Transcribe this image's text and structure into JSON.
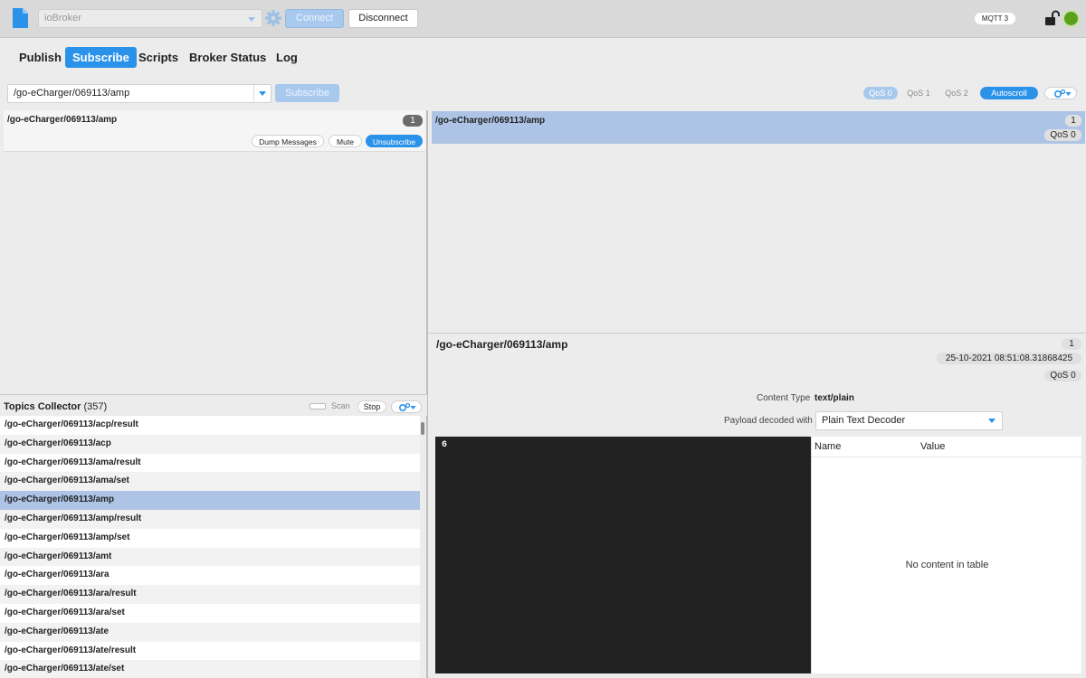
{
  "toolbar": {
    "profile_value": "ioBroker",
    "connect_label": "Connect",
    "disconnect_label": "Disconnect",
    "protocol_badge": "MQTT 3",
    "connection_status_color": "#5aa01a"
  },
  "tabs": [
    {
      "label": "Publish",
      "active": false
    },
    {
      "label": "Subscribe",
      "active": true
    },
    {
      "label": "Scripts",
      "active": false
    },
    {
      "label": "Broker Status",
      "active": false
    },
    {
      "label": "Log",
      "active": false
    }
  ],
  "subscribe_bar": {
    "topic_value": "/go-eCharger/069113/amp",
    "subscribe_label": "Subscribe",
    "qos_options": [
      "QoS 0",
      "QoS 1",
      "QoS 2"
    ],
    "qos_selected": "QoS 0",
    "autoscroll_label": "Autoscroll"
  },
  "subscriptions": [
    {
      "topic": "/go-eCharger/069113/amp",
      "count": "1",
      "buttons": {
        "dump": "Dump Messages",
        "mute": "Mute",
        "unsubscribe": "Unsubscribe"
      }
    }
  ],
  "messages": [
    {
      "topic": "/go-eCharger/069113/amp",
      "count": "1",
      "qos": "QoS 0"
    }
  ],
  "topics_collector": {
    "title": "Topics Collector",
    "count": "(357)",
    "scan_label": "Scan",
    "stop_label": "Stop",
    "selected_index": 4,
    "topics": [
      "/go-eCharger/069113/acp/result",
      "/go-eCharger/069113/acp",
      "/go-eCharger/069113/ama/result",
      "/go-eCharger/069113/ama/set",
      "/go-eCharger/069113/amp",
      "/go-eCharger/069113/amp/result",
      "/go-eCharger/069113/amp/set",
      "/go-eCharger/069113/amt",
      "/go-eCharger/069113/ara",
      "/go-eCharger/069113/ara/result",
      "/go-eCharger/069113/ara/set",
      "/go-eCharger/069113/ate",
      "/go-eCharger/069113/ate/result",
      "/go-eCharger/069113/ate/set"
    ]
  },
  "detail": {
    "topic": "/go-eCharger/069113/amp",
    "count": "1",
    "timestamp": "25-10-2021  08:51:08.31868425",
    "qos": "QoS 0",
    "content_type_label": "Content Type",
    "content_type_value": "text/plain",
    "payload_decoded_label": "Payload decoded with",
    "decoder_value": "Plain Text Decoder",
    "payload": "6",
    "table_headers": {
      "name": "Name",
      "value": "Value"
    },
    "table_empty_text": "No content in table"
  }
}
